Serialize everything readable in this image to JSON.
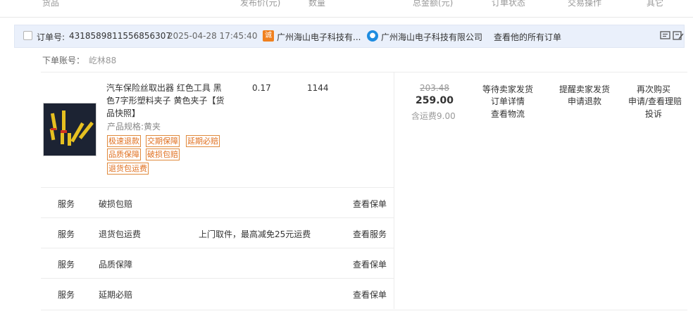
{
  "columns": [
    "货品",
    "发布价(元)",
    "数量",
    "总金额(元)",
    "订单状态",
    "交易操作",
    "其它"
  ],
  "order": {
    "label": "订单号:",
    "number": "4318589811556856307",
    "datetime": "2025-04-28 17:45:40",
    "shop_badge": "诚",
    "shop_name": "广州海山电子科技有...",
    "seller_name": "广州海山电子科技有限公司",
    "view_all": "查看他的所有订单"
  },
  "account": {
    "label": "下单账号：",
    "value": "屹林88"
  },
  "product": {
    "title": "汽车保险丝取出器 红色工具 黑色7字形塑料夹子 黄色夹子【货品快照】",
    "spec": "产品规格:黄夹",
    "tags": [
      "极速退款",
      "交期保障",
      "延期必赔",
      "品质保障",
      "破损包赔",
      "退货包运费"
    ],
    "price": "0.17",
    "quantity": "1144"
  },
  "amount": {
    "original": "203.48",
    "total": "259.00",
    "shipping": "含运费9.00"
  },
  "status": {
    "state": "等待卖家发货",
    "detail": "订单详情",
    "logistics": "查看物流"
  },
  "actions": {
    "remind": "提醒卖家发货",
    "refund": "申请退款"
  },
  "other": {
    "rebuy": "再次购买",
    "apply": "申请/查看理赔",
    "complain": "投诉"
  },
  "services": [
    {
      "label": "服务",
      "name": "破损包赔",
      "desc": "",
      "action": "查看保单"
    },
    {
      "label": "服务",
      "name": "退货包运费",
      "desc": "上门取件，最高减免25元运费",
      "action": "查看服务"
    },
    {
      "label": "服务",
      "name": "品质保障",
      "desc": "",
      "action": "查看保单"
    },
    {
      "label": "服务",
      "name": "延期必赔",
      "desc": "",
      "action": "查看保单"
    }
  ],
  "colors": {
    "tag_orange": "#e07020",
    "header_bg": "#eaf0fb",
    "badge": "#f0801e",
    "wangwang": "#1e8ce0"
  },
  "icons": [
    "checkbox-icon",
    "shop-badge-icon",
    "wangwang-icon",
    "memo-icon",
    "edit-note-icon"
  ]
}
